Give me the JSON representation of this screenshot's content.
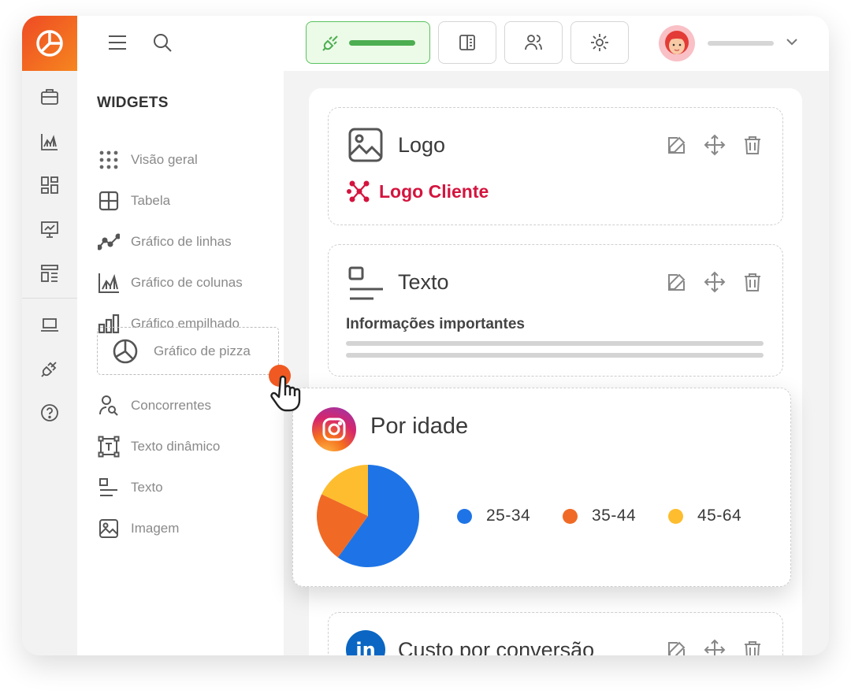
{
  "sidebar": {
    "title": "WIDGETS",
    "items": [
      {
        "label": "Visão geral"
      },
      {
        "label": "Tabela"
      },
      {
        "label": "Gráfico de linhas"
      },
      {
        "label": "Gráfico de colunas"
      },
      {
        "label": "Gráfico empilhado"
      },
      {
        "label": "Gráfico de pizza"
      },
      {
        "label": "Concorrentes"
      },
      {
        "label": "Texto dinâmico"
      },
      {
        "label": "Texto"
      },
      {
        "label": "Imagem"
      }
    ]
  },
  "widgets": {
    "logo": {
      "title": "Logo",
      "client": "Logo Cliente"
    },
    "text": {
      "title": "Texto",
      "subtitle": "Informações importantes"
    },
    "pie": {
      "title": "Por idade"
    },
    "cost": {
      "title": "Custo por conversão"
    }
  },
  "chart_data": {
    "type": "pie",
    "categories": [
      "25-34",
      "35-44",
      "45-64"
    ],
    "values": [
      60,
      22,
      18
    ],
    "colors": [
      "#1e74e6",
      "#f06a25",
      "#fdbd2e"
    ]
  },
  "icons": {
    "brand": "pie-chart-icon",
    "topbar": [
      "menu-icon",
      "search-icon",
      "plug-icon",
      "report-icon",
      "users-icon",
      "settings-icon",
      "chevron-down-icon"
    ]
  },
  "colors": {
    "brand_gradient_start": "#ee4a24",
    "brand_gradient_end": "#f6861f",
    "active_button_border": "#59c25f",
    "active_button_bg": "#ecfbe8",
    "logo_client": "#d4143e",
    "linkedin": "#0a66c2"
  }
}
